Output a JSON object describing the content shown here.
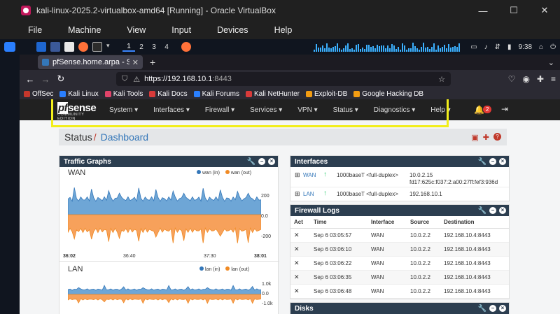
{
  "window": {
    "title": "kali-linux-2025.2-virtualbox-amd64 [Running] - Oracle VirtualBox",
    "minimize": "—",
    "maximize": "☐",
    "close": "✕"
  },
  "vbox_menu": [
    "File",
    "Machine",
    "View",
    "Input",
    "Devices",
    "Help"
  ],
  "kali_panel": {
    "workspaces": [
      "1",
      "2",
      "3",
      "4"
    ],
    "time": "9:38"
  },
  "firefox": {
    "tab_title": "pfSense.home.arpa - Stat",
    "tab_close": "✕",
    "new_tab": "+",
    "url_host": "https://192.168.10.1",
    "url_port": ":8443",
    "bookmarks": [
      "OffSec",
      "Kali Linux",
      "Kali Tools",
      "Kali Docs",
      "Kali Forums",
      "Kali NetHunter",
      "Exploit-DB",
      "Google Hacking DB"
    ]
  },
  "pfsense": {
    "logo_main": "sense",
    "logo_pf": "pf",
    "logo_sub": "COMMUNITY EDITION",
    "menu": [
      "System ▾",
      "Interfaces ▾",
      "Firewall ▾",
      "Services ▾",
      "VPN ▾",
      "Status ▾",
      "Diagnostics ▾",
      "Help ▾"
    ],
    "notification_count": "2",
    "breadcrumb_status": "Status",
    "breadcrumb_sep": "/",
    "breadcrumb_page": "Dashboard",
    "traffic": {
      "title": "Traffic Graphs",
      "wan_label": "WAN",
      "wan_legend_in": "wan (in)",
      "wan_legend_out": "wan (out)",
      "wan_y_ticks": [
        "200",
        "0.0",
        "-200"
      ],
      "wan_x_ticks": [
        "36:02",
        "36:40",
        "37:30",
        "38:01"
      ],
      "lan_label": "LAN",
      "lan_legend_in": "lan (in)",
      "lan_legend_out": "lan (out)",
      "lan_y_ticks": [
        "1.0k",
        "0.0",
        "-1.0k"
      ],
      "color_in": "#6ea6d6",
      "color_out": "#f7a15b"
    },
    "interfaces": {
      "title": "Interfaces",
      "rows": [
        {
          "name": "WAN",
          "speed": "1000baseT <full-duplex>",
          "ip1": "10.0.2.15",
          "ip2": "fd17:625c:f037:2:a00:27ff:fef3:936d"
        },
        {
          "name": "LAN",
          "speed": "1000baseT <full-duplex>",
          "ip1": "192.168.10.1",
          "ip2": ""
        }
      ]
    },
    "firewall_logs": {
      "title": "Firewall Logs",
      "headers": [
        "Act",
        "Time",
        "Interface",
        "Source",
        "Destination"
      ],
      "rows": [
        {
          "act": "✕",
          "time": "Sep 6 03:05:57",
          "iface": "WAN",
          "src": "10.0.2.2",
          "dst": "192.168.10.4:8443"
        },
        {
          "act": "✕",
          "time": "Sep 6 03:06:10",
          "iface": "WAN",
          "src": "10.0.2.2",
          "dst": "192.168.10.4:8443"
        },
        {
          "act": "✕",
          "time": "Sep 6 03:06:22",
          "iface": "WAN",
          "src": "10.0.2.2",
          "dst": "192.168.10.4:8443"
        },
        {
          "act": "✕",
          "time": "Sep 6 03:06:35",
          "iface": "WAN",
          "src": "10.0.2.2",
          "dst": "192.168.10.4:8443"
        },
        {
          "act": "✕",
          "time": "Sep 6 03:06:48",
          "iface": "WAN",
          "src": "10.0.2.2",
          "dst": "192.168.10.4:8443"
        }
      ]
    },
    "disks": {
      "title": "Disks"
    }
  }
}
